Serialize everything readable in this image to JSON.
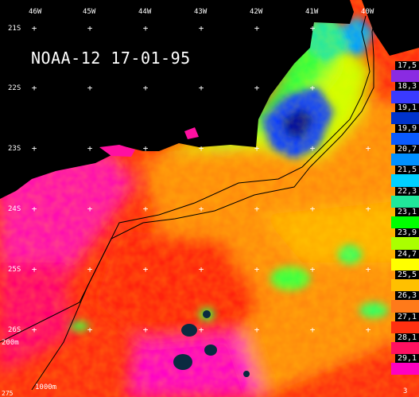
{
  "title": "NOAA-12 17-01-95",
  "longitudes": [
    "46W",
    "45W",
    "44W",
    "43W",
    "42W",
    "41W",
    "40W"
  ],
  "latitudes": [
    "21S",
    "22S",
    "23S",
    "24S",
    "25S",
    "26S"
  ],
  "isobaths": {
    "shelf": "200m",
    "slope": "1000m"
  },
  "corner_labels": {
    "bottom_left": "275",
    "bottom_right": "3"
  },
  "temperature_scale": [
    {
      "value": "17,5",
      "color": "#8a2be2"
    },
    {
      "value": "18,3",
      "color": "#3a3aff"
    },
    {
      "value": "19,1",
      "color": "#0033cc"
    },
    {
      "value": "19,9",
      "color": "#0a5aff"
    },
    {
      "value": "20,7",
      "color": "#0090ff"
    },
    {
      "value": "21,5",
      "color": "#00d0ff"
    },
    {
      "value": "22,3",
      "color": "#20e89a"
    },
    {
      "value": "23,1",
      "color": "#00ff00"
    },
    {
      "value": "23,9",
      "color": "#aaff00"
    },
    {
      "value": "24,7",
      "color": "#ffff00"
    },
    {
      "value": "25,5",
      "color": "#ffc000"
    },
    {
      "value": "26,3",
      "color": "#ff7a1a"
    },
    {
      "value": "27,1",
      "color": "#ff3010"
    },
    {
      "value": "28,1",
      "color": "#ff1060"
    },
    {
      "value": "29,1",
      "color": "#ff00c0"
    }
  ],
  "colors": {
    "land": "#000000",
    "warm": "#ff2020",
    "hot": "#ff00aa",
    "mid": "#ff8a10",
    "cool": "#30ff40",
    "cold": "#1040ff"
  }
}
